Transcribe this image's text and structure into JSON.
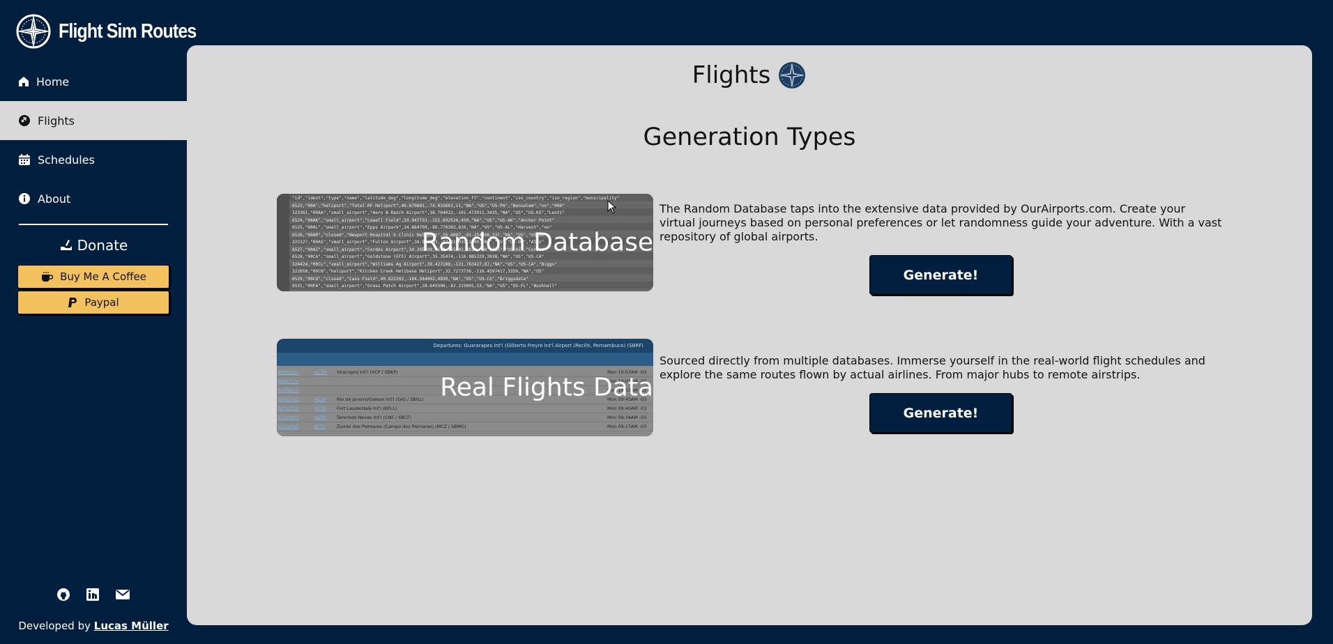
{
  "app": {
    "logo_text": "Flight Sim Routes"
  },
  "sidebar": {
    "items": [
      {
        "label": "Home",
        "icon": "home-icon"
      },
      {
        "label": "Flights",
        "icon": "plane-circle-icon",
        "active": true
      },
      {
        "label": "Schedules",
        "icon": "calendar-icon"
      },
      {
        "label": "About",
        "icon": "info-icon"
      }
    ],
    "donate_label": "Donate",
    "buttons": [
      {
        "label": "Buy Me A Coffee",
        "icon": "coffee-icon"
      },
      {
        "label": "Paypal",
        "icon": "paypal-icon"
      }
    ],
    "social": [
      "github-icon",
      "linkedin-icon",
      "mail-icon"
    ],
    "credit_prefix": "Developed by",
    "credit_name": "Lucas Müller"
  },
  "main": {
    "title": "Flights",
    "section_title": "Generation Types",
    "types": [
      {
        "label": "Random Database",
        "description": "The Random Database taps into the extensive data provided by OurAirports.com. Create your virtual journeys based on personal preferences or let randomness guide your adventure. With a vast repository of global airports.",
        "button": "Generate!"
      },
      {
        "label": "Real Flights Data",
        "description": "Sourced directly from multiple databases. Immerse yourself in the real-world flight schedules and explore the same routes flown by actual airlines. From major hubs to remote airstrips.",
        "button": "Generate!"
      }
    ]
  },
  "colors": {
    "navy": "#001f3f",
    "panel": "#d9d9d9",
    "donate_yellow": "#f3c25f"
  }
}
